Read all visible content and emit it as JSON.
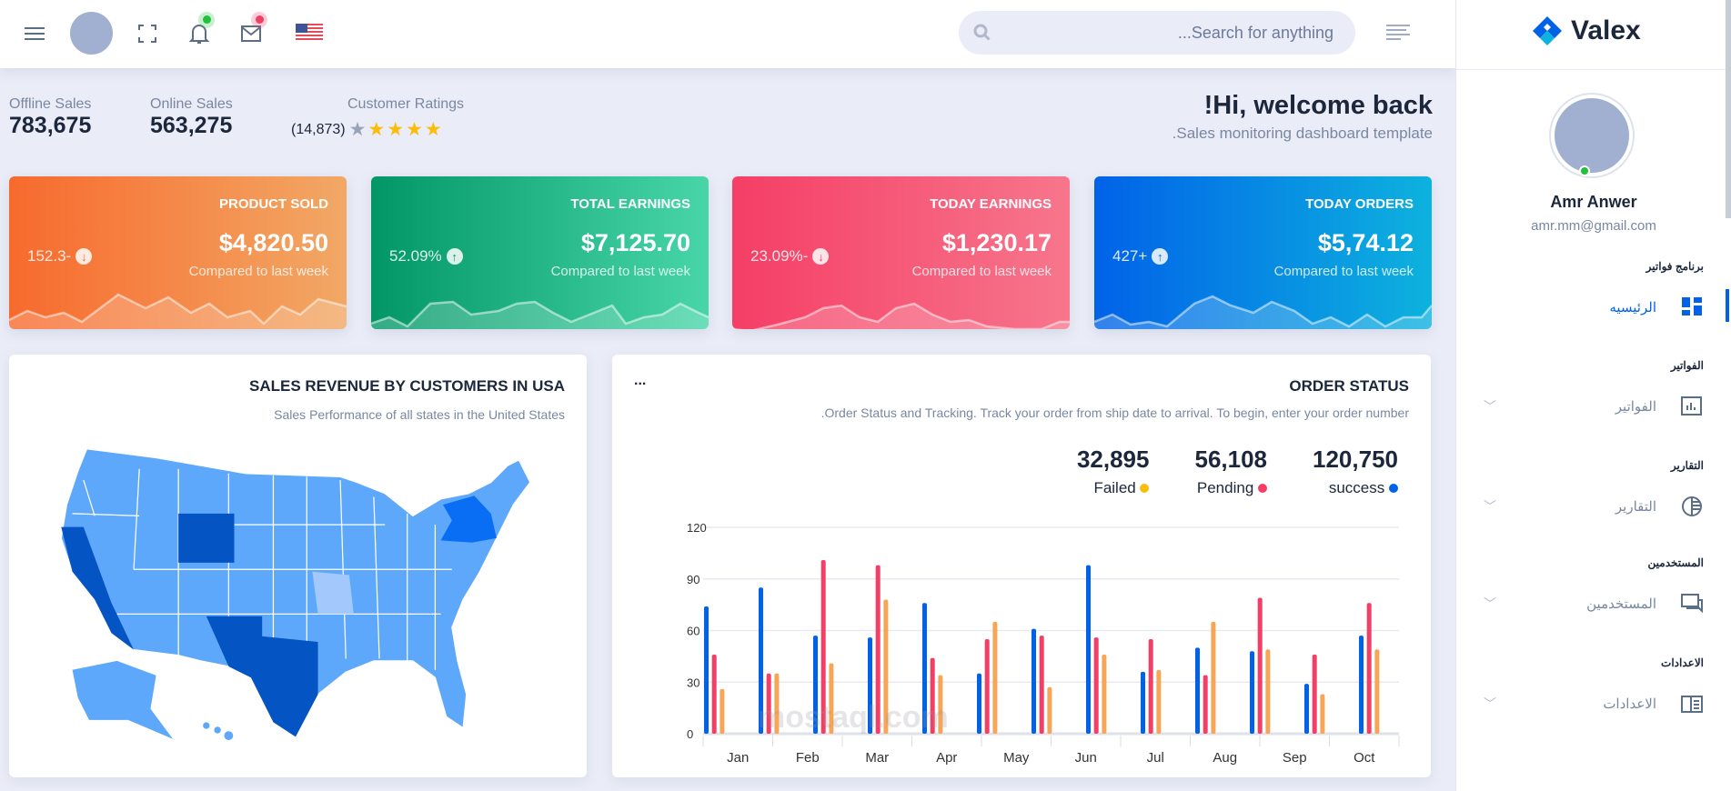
{
  "header": {
    "search_placeholder": "...Search for anything",
    "flag": "us-flag"
  },
  "stats": [
    {
      "label": "Offline Sales",
      "value": "783,675"
    },
    {
      "label": "Online Sales",
      "value": "563,275"
    }
  ],
  "ratings": {
    "label": "Customer Ratings",
    "count": "(14,873)",
    "stars_filled": 4,
    "stars_total": 5
  },
  "welcome": {
    "title": "!Hi, welcome back",
    "subtitle": ".Sales monitoring dashboard template"
  },
  "cards": [
    {
      "title": "PRODUCT SOLD",
      "value": "$4,820.50",
      "compare": "Compared to last week",
      "change": "152.3-",
      "direction": "down",
      "colors": [
        "#f76a2d",
        "#f2a865"
      ]
    },
    {
      "title": "TOTAL EARNINGS",
      "value": "$7,125.70",
      "compare": "Compared to last week",
      "change": "52.09%",
      "direction": "up",
      "colors": [
        "#029666",
        "#48d6a8"
      ]
    },
    {
      "title": "TODAY EARNINGS",
      "value": "$1,230.17",
      "compare": "Compared to last week",
      "change": "23.09%-",
      "direction": "down",
      "colors": [
        "#f53e65",
        "#f7768c"
      ]
    },
    {
      "title": "TODAY ORDERS",
      "value": "$5,74.12",
      "compare": "Compared to last week",
      "change": "427+",
      "direction": "up",
      "colors": [
        "#0162e8",
        "#0db2de"
      ]
    }
  ],
  "map_panel": {
    "title": "SALES REVENUE BY CUSTOMERS IN USA",
    "subtitle": "Sales Performance of all states in the United States"
  },
  "order_panel": {
    "title": "ORDER STATUS",
    "subtitle": ".Order Status and Tracking. Track your order from ship date to arrival. To begin, enter your order number",
    "menu": "...",
    "totals": [
      {
        "value": "32,895",
        "label": "Failed",
        "color": "#fbbc0b"
      },
      {
        "value": "56,108",
        "label": "Pending",
        "color": "#f53e65"
      },
      {
        "value": "120,750",
        "label": "success",
        "color": "#0162e8"
      }
    ]
  },
  "chart_data": {
    "type": "bar",
    "xlabels": [
      "Jan",
      "Feb",
      "Mar",
      "Apr",
      "May",
      "Jun",
      "Jul",
      "Aug",
      "Sep",
      "Oct"
    ],
    "yticks": [
      0,
      30,
      60,
      90,
      120
    ],
    "ylim": [
      0,
      120
    ],
    "series": [
      {
        "name": "success",
        "color": "#0162e8",
        "values": [
          74,
          85,
          57,
          56,
          76,
          35,
          61,
          98,
          36,
          50,
          48,
          29,
          57
        ]
      },
      {
        "name": "Pending",
        "color": "#f53e65",
        "values": [
          46,
          35,
          101,
          98,
          44,
          55,
          57,
          56,
          55,
          34,
          79,
          46,
          76
        ]
      },
      {
        "name": "Failed",
        "color": "#f7a556",
        "values": [
          26,
          35,
          41,
          78,
          34,
          65,
          27,
          46,
          37,
          65,
          49,
          23,
          49
        ]
      }
    ]
  },
  "sidebar": {
    "brand": "Valex",
    "user_name": "Amr Anwer",
    "user_email": "amr.mm@gmail.com",
    "sections": [
      {
        "heading": "برنامج فواتير",
        "item": "الرئيسيه",
        "active": true
      },
      {
        "heading": "الفواتير",
        "item": "الفواتير"
      },
      {
        "heading": "التقارير",
        "item": "التقارير"
      },
      {
        "heading": "المستخدمين",
        "item": "المستخدمين"
      },
      {
        "heading": "الاعدادات",
        "item": "الاعدادات"
      }
    ]
  },
  "watermark": "mostaql.com"
}
